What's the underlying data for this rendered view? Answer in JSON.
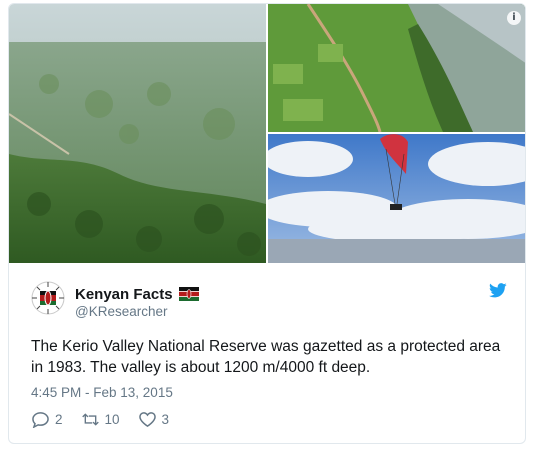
{
  "tweet": {
    "author_name": "Kenyan Facts",
    "author_handle": "@KResearcher",
    "text": "The Kerio Valley National Reserve was gazetted as a protected area in 1983. The valley is about 1200 m/4000 ft deep.",
    "timestamp": "4:45 PM - Feb 13, 2015",
    "reply_count": "2",
    "retweet_count": "10",
    "like_count": "3"
  },
  "icons": {
    "info": "info-icon",
    "verified_flag": "kenya-flag-icon",
    "brand": "twitter-bird-icon",
    "reply": "reply-icon",
    "retweet": "retweet-icon",
    "like": "heart-icon"
  },
  "colors": {
    "brand_blue": "#1da1f2",
    "secondary_text": "#657786",
    "primary_text": "#14171a",
    "border": "#e1e8ed"
  },
  "info_glyph": "i"
}
